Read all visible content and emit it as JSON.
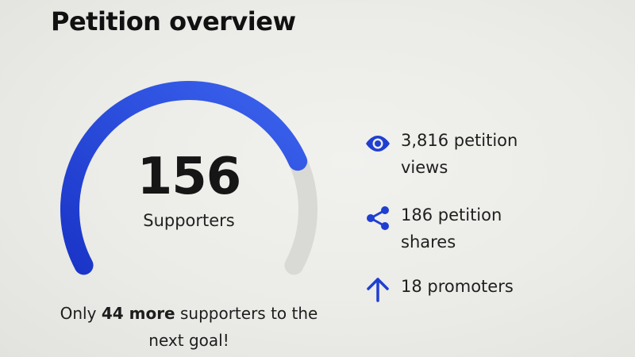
{
  "page": {
    "title": "Petition overview"
  },
  "gauge": {
    "value": "156",
    "label": "Supporters",
    "progress_fraction": 0.78,
    "colors": {
      "fill_start": "#1a35c8",
      "fill_end": "#3b63ee",
      "track": "#d9d9d6"
    }
  },
  "goal": {
    "prefix": "Only",
    "highlight": "44 more",
    "suffix": "supporters to the next goal!"
  },
  "stats": {
    "views": {
      "line1": "3,816 petition",
      "line2": "views",
      "icon": "eye-icon"
    },
    "shares": {
      "line1": "186 petition",
      "line2": "shares",
      "icon": "share-icon"
    },
    "promoters": {
      "line1": "18 promoters",
      "icon": "arrow-up-icon"
    }
  },
  "colors": {
    "accent": "#1f3fd1"
  }
}
